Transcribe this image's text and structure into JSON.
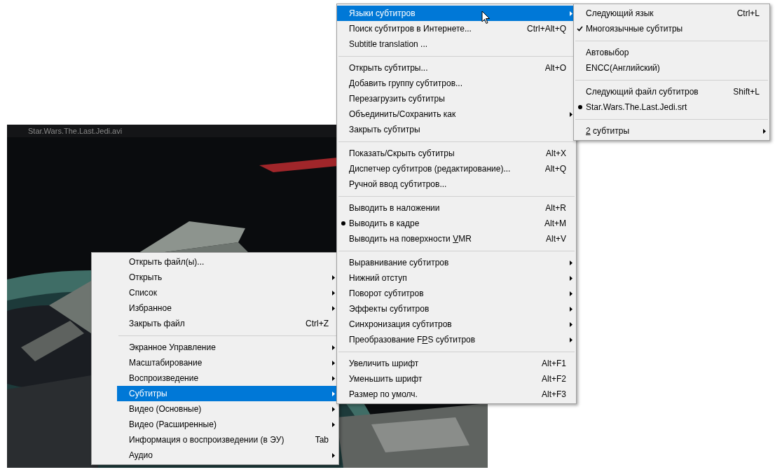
{
  "player": {
    "title": "Star.Wars.The.Last.Jedi.avi"
  },
  "context_menu": {
    "items": [
      {
        "kind": "item",
        "label": "Открыть файл(ы)...",
        "submenu": false,
        "selected": false,
        "checked": false
      },
      {
        "kind": "item",
        "label": "Открыть",
        "submenu": true,
        "selected": false,
        "checked": false
      },
      {
        "kind": "item",
        "label": "Список",
        "submenu": true,
        "selected": false,
        "checked": false
      },
      {
        "kind": "item",
        "label": "Избранное",
        "submenu": true,
        "selected": false,
        "checked": false
      },
      {
        "kind": "item",
        "label": "Закрыть файл",
        "shortcut": "Ctrl+Z",
        "submenu": false,
        "selected": false,
        "checked": false
      },
      {
        "kind": "separator"
      },
      {
        "kind": "item",
        "label": "Экранное Управление",
        "submenu": true,
        "selected": false,
        "checked": false
      },
      {
        "kind": "item",
        "label": "Масштабирование",
        "submenu": true,
        "selected": false,
        "checked": false
      },
      {
        "kind": "item",
        "label": "Воспроизведение",
        "submenu": true,
        "selected": false,
        "checked": false
      },
      {
        "kind": "item",
        "label": "Субтитры",
        "submenu": true,
        "selected": true,
        "checked": false
      },
      {
        "kind": "item",
        "label": "Видео (Основные)",
        "submenu": true,
        "selected": false,
        "checked": false
      },
      {
        "kind": "item",
        "label": "Видео (Расширенные)",
        "submenu": true,
        "selected": false,
        "checked": false
      },
      {
        "kind": "item",
        "label": "Информация о воспроизведении (в ЭУ)",
        "shortcut": "Tab",
        "submenu": false,
        "selected": false,
        "checked": false
      },
      {
        "kind": "item",
        "label": "Аудио",
        "submenu": true,
        "selected": false,
        "checked": false
      }
    ]
  },
  "subtitles_submenu": {
    "items": [
      {
        "kind": "item",
        "label": "Языки субтитров",
        "submenu": true,
        "selected": true,
        "checked": false
      },
      {
        "kind": "item",
        "label": "Поиск субтитров в Интернете...",
        "shortcut": "Ctrl+Alt+Q",
        "submenu": false,
        "selected": false,
        "checked": false
      },
      {
        "kind": "item",
        "label": "Subtitle translation ...",
        "submenu": false,
        "selected": false,
        "checked": false
      },
      {
        "kind": "separator"
      },
      {
        "kind": "item",
        "label": "Открыть субтитры...",
        "shortcut": "Alt+O",
        "submenu": false,
        "selected": false,
        "checked": false
      },
      {
        "kind": "item",
        "label": "Добавить группу субтитров...",
        "submenu": false,
        "selected": false,
        "checked": false
      },
      {
        "kind": "item",
        "label": "Перезагрузить субтитры",
        "submenu": false,
        "selected": false,
        "checked": false
      },
      {
        "kind": "item",
        "label": "Объединить/Сохранить как",
        "submenu": true,
        "selected": false,
        "checked": false
      },
      {
        "kind": "item",
        "label": "Закрыть субтитры",
        "submenu": false,
        "selected": false,
        "checked": false
      },
      {
        "kind": "separator"
      },
      {
        "kind": "item",
        "label": "Показать/Скрыть субтитры",
        "shortcut": "Alt+X",
        "submenu": false,
        "selected": false,
        "checked": false
      },
      {
        "kind": "item",
        "label": "Диспетчер субтитров (редактирование)...",
        "shortcut": "Alt+Q",
        "submenu": false,
        "selected": false,
        "checked": false
      },
      {
        "kind": "item",
        "label": "Ручной ввод субтитров...",
        "submenu": false,
        "selected": false,
        "checked": false
      },
      {
        "kind": "separator"
      },
      {
        "kind": "item",
        "label": "Выводить в наложении",
        "shortcut": "Alt+R",
        "submenu": false,
        "selected": false,
        "checked": false
      },
      {
        "kind": "item",
        "label": "Выводить в кадре",
        "shortcut": "Alt+M",
        "submenu": false,
        "selected": false,
        "checked": true,
        "radio": true
      },
      {
        "kind": "item",
        "label": {
          "before": "Выводить на поверхности ",
          "mnemonic": "V",
          "after": "MR"
        },
        "shortcut": "Alt+V",
        "submenu": false,
        "selected": false,
        "checked": false
      },
      {
        "kind": "separator"
      },
      {
        "kind": "item",
        "label": "Выравнивание субтитров",
        "submenu": true,
        "selected": false,
        "checked": false
      },
      {
        "kind": "item",
        "label": "Нижний отступ",
        "submenu": true,
        "selected": false,
        "checked": false
      },
      {
        "kind": "item",
        "label": "Поворот субтитров",
        "submenu": true,
        "selected": false,
        "checked": false
      },
      {
        "kind": "item",
        "label": "Эффекты субтитров",
        "submenu": true,
        "selected": false,
        "checked": false
      },
      {
        "kind": "item",
        "label": "Синхронизация субтитров",
        "submenu": true,
        "selected": false,
        "checked": false
      },
      {
        "kind": "item",
        "label": {
          "before": "Преобразование F",
          "mnemonic": "P",
          "after": "S субтитров"
        },
        "submenu": true,
        "selected": false,
        "checked": false
      },
      {
        "kind": "separator"
      },
      {
        "kind": "item",
        "label": "Увеличить шрифт",
        "shortcut": "Alt+F1",
        "submenu": false,
        "selected": false,
        "checked": false
      },
      {
        "kind": "item",
        "label": "Уменьшить шрифт",
        "shortcut": "Alt+F2",
        "submenu": false,
        "selected": false,
        "checked": false
      },
      {
        "kind": "item",
        "label": "Размер по умолч.",
        "shortcut": "Alt+F3",
        "submenu": false,
        "selected": false,
        "checked": false
      }
    ]
  },
  "languages_submenu": {
    "items": [
      {
        "kind": "item",
        "label": "Следующий язык",
        "shortcut": "Ctrl+L",
        "submenu": false,
        "selected": false,
        "checked": false
      },
      {
        "kind": "item",
        "label": "Многоязычные субтитры",
        "submenu": false,
        "selected": false,
        "checked": true
      },
      {
        "kind": "separator"
      },
      {
        "kind": "item",
        "label": "Автовыбор",
        "submenu": false,
        "selected": false,
        "checked": false
      },
      {
        "kind": "item",
        "label": "ENCC(Английский)",
        "submenu": false,
        "selected": false,
        "checked": false
      },
      {
        "kind": "separator"
      },
      {
        "kind": "item",
        "label": "Следующий файл субтитров",
        "shortcut": "Shift+L",
        "submenu": false,
        "selected": false,
        "checked": false
      },
      {
        "kind": "item",
        "label": "Star.Wars.The.Last.Jedi.srt",
        "submenu": false,
        "selected": false,
        "checked": true,
        "radio": true
      },
      {
        "kind": "separator"
      },
      {
        "kind": "item",
        "label": {
          "mnemonic": "2",
          "after": " субтитры"
        },
        "submenu": true,
        "selected": false,
        "checked": false
      }
    ]
  }
}
